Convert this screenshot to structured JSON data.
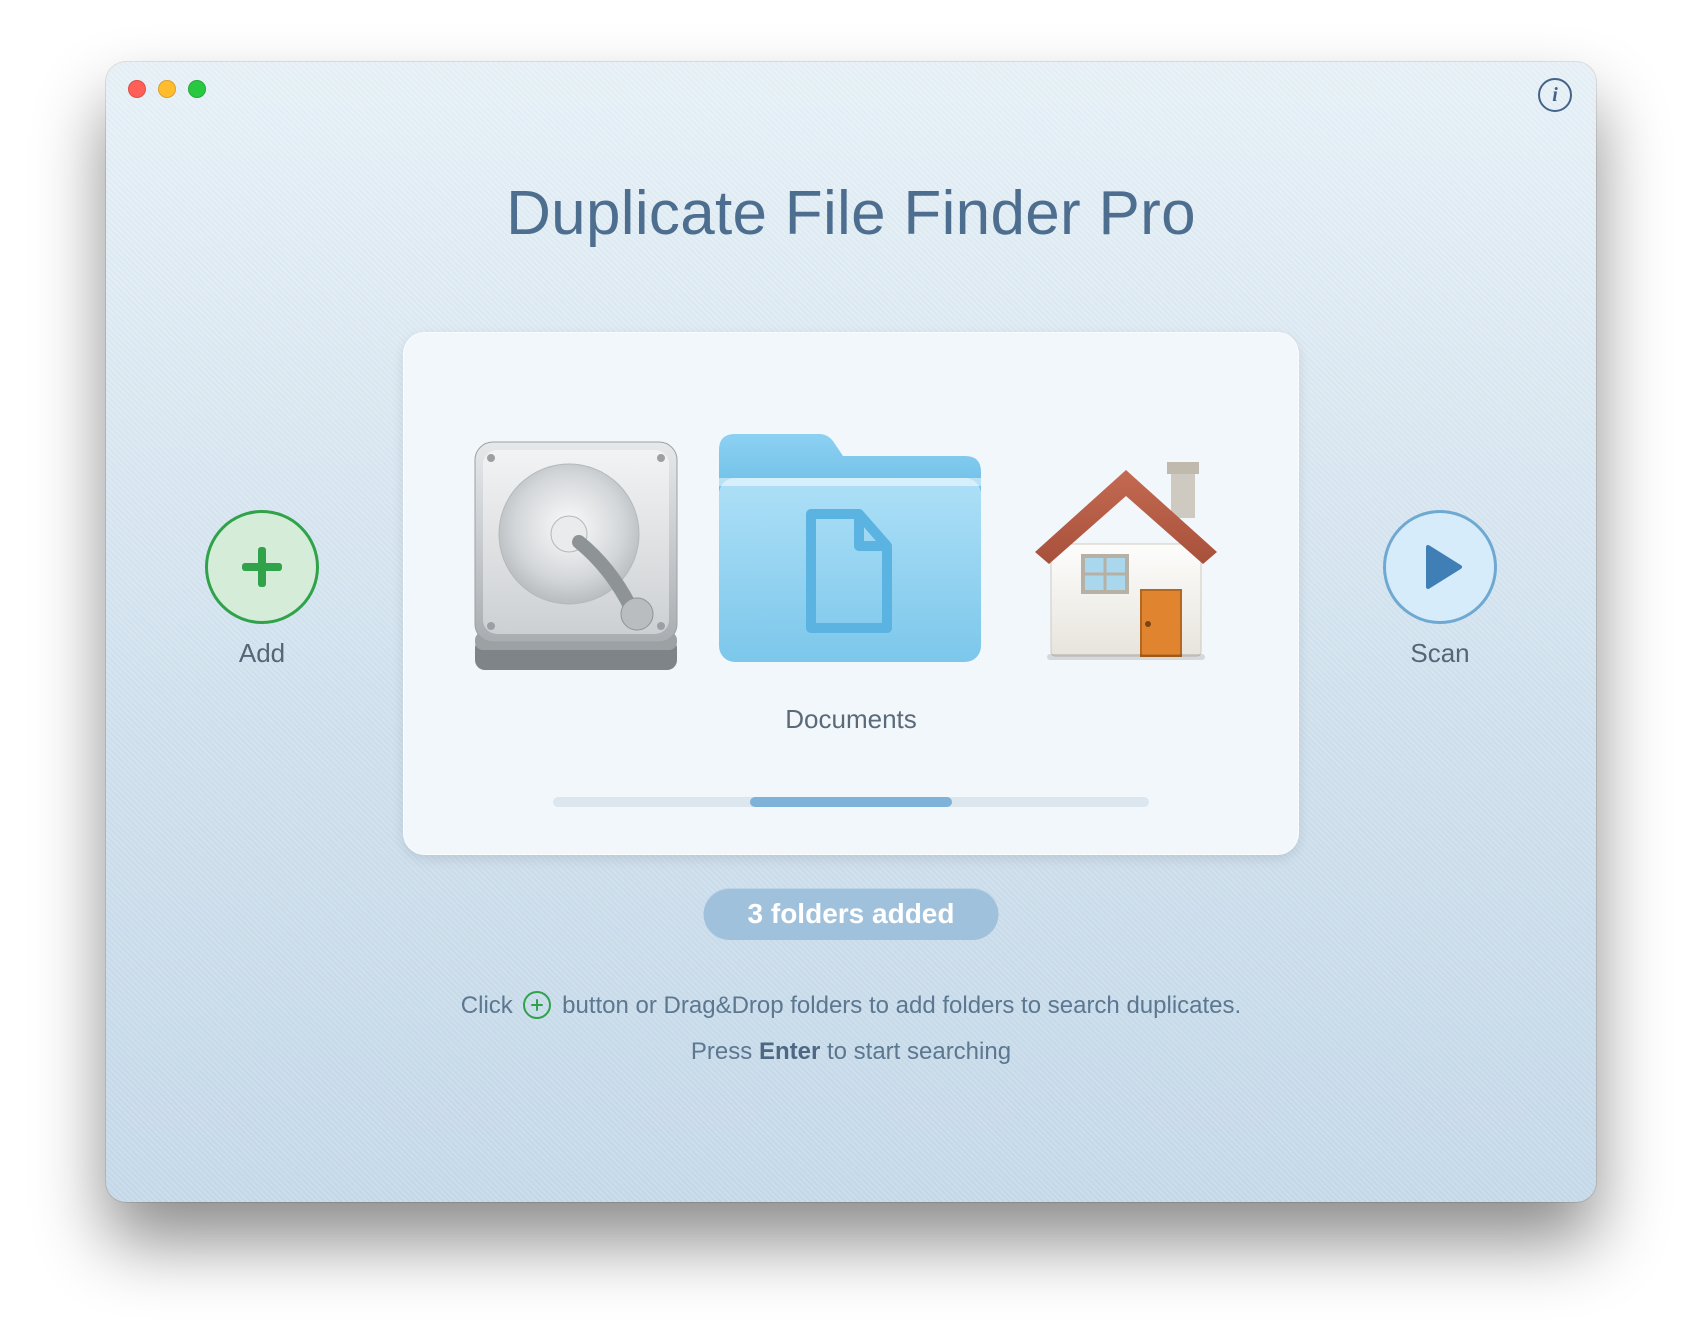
{
  "app": {
    "title": "Duplicate File Finder Pro"
  },
  "titlebar": {
    "info_button": "i"
  },
  "buttons": {
    "add": {
      "label": "Add"
    },
    "scan": {
      "label": "Scan"
    }
  },
  "card": {
    "items": [
      {
        "id": "hdd",
        "label": ""
      },
      {
        "id": "documents",
        "label": "Documents"
      },
      {
        "id": "home",
        "label": ""
      }
    ],
    "caption": "Documents"
  },
  "status": {
    "pill": "3 folders added"
  },
  "hints": {
    "line1_pre": "Click ",
    "line1_post": " button or Drag&Drop folders to add folders to search duplicates.",
    "line2_pre": "Press ",
    "line2_bold": "Enter",
    "line2_post": " to start searching"
  },
  "icons": {
    "plus": "plus-icon",
    "play": "play-icon",
    "info": "info-icon",
    "hdd": "harddrive-icon",
    "folder": "folder-icon",
    "home": "home-icon"
  }
}
